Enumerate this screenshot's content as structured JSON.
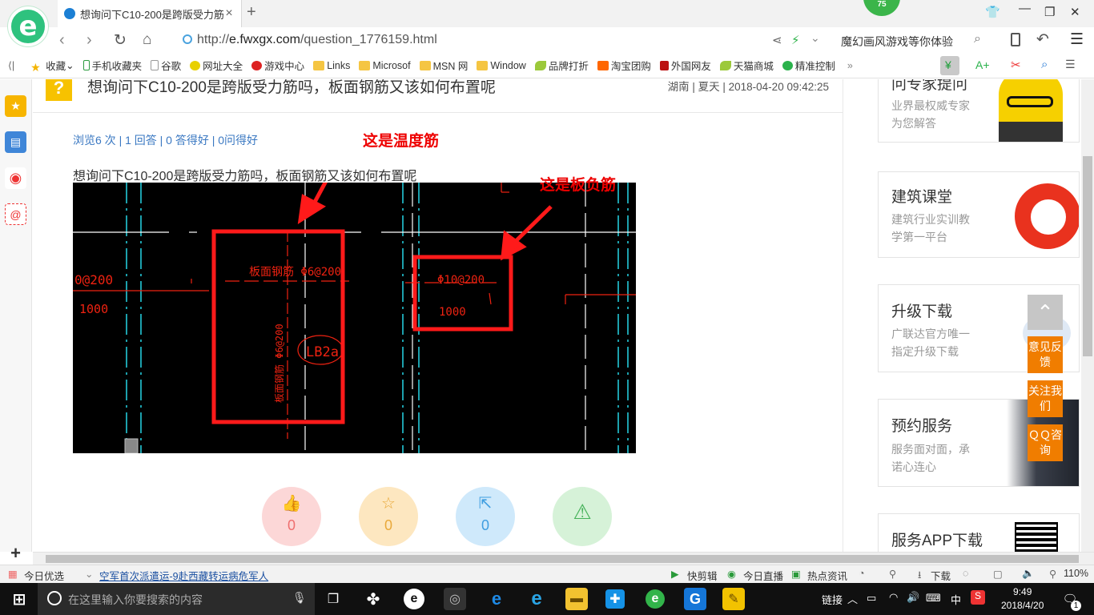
{
  "browser": {
    "tab_title": "想询问下C10-200是跨版受力筋吗",
    "tab_close": "×",
    "new_tab": "+",
    "badge_count": "75",
    "url_prefix": "http://",
    "url_domain": "e.fwxgx.com",
    "url_path": "/question_1776159.html",
    "search_text": "魔幻画风游戏等你体验"
  },
  "bookmarks": [
    {
      "label": "收藏",
      "icon": "star-icon"
    },
    {
      "label": "手机收藏夹",
      "icon": "phone-icon"
    },
    {
      "label": "谷歌",
      "icon": "page-icon"
    },
    {
      "label": "网址大全",
      "icon": "globe-icon"
    },
    {
      "label": "游戏中心",
      "icon": "game-icon"
    },
    {
      "label": "Links",
      "icon": "folder-icon"
    },
    {
      "label": "Microsof",
      "icon": "folder-icon"
    },
    {
      "label": "MSN 网",
      "icon": "folder-icon"
    },
    {
      "label": "Window",
      "icon": "folder-icon"
    },
    {
      "label": "品牌打折",
      "icon": "leaf-icon"
    },
    {
      "label": "淘宝团购",
      "icon": "taobao-icon"
    },
    {
      "label": "外国网友",
      "icon": "flag-icon"
    },
    {
      "label": "天猫商城",
      "icon": "leaf-icon"
    },
    {
      "label": "精准控制",
      "icon": "chat-icon"
    }
  ],
  "question": {
    "title": "想询问下C10-200是跨版受力筋吗，板面钢筋又该如何布置呢",
    "meta": "湖南 | 夏天 | 2018-04-20 09:42:25",
    "stats": "浏览6 次 | 1 回答 | 0 答得好 | 0问得好",
    "body": "想询问下C10-200是跨版受力筋吗，板面钢筋又该如何布置呢"
  },
  "drawing": {
    "annotation_temp": "这是温度筋",
    "annotation_neg": "这是板负筋",
    "label_left": "0@200",
    "label_left_len": "1000",
    "label_top": "板面钢筋 Φ6@200",
    "label_vertical": "板面钢筋 Φ6@200",
    "label_right": "Φ10@200",
    "label_right_len": "1000",
    "label_slab": "LB2a"
  },
  "actions": [
    {
      "icon": "thumbs-up-icon",
      "glyph": "👍",
      "count": "0",
      "bg": "#fcd7d7",
      "fg": "#ef6f6f"
    },
    {
      "icon": "star-icon",
      "glyph": "☆",
      "count": "0",
      "bg": "#fde7c0",
      "fg": "#e9a93a"
    },
    {
      "icon": "share-icon",
      "glyph": "⇱",
      "count": "0",
      "bg": "#cfe9fb",
      "fg": "#3f9ee0"
    },
    {
      "icon": "warning-icon",
      "glyph": "⚠",
      "count": "",
      "bg": "#d6f2d8",
      "fg": "#46b25a"
    }
  ],
  "right_cards": [
    {
      "title": "问专家提问",
      "sub1": "业界最权威专家",
      "sub2": "为您解答"
    },
    {
      "title": "建筑课堂",
      "sub1": "建筑行业实训教",
      "sub2": "学第一平台"
    },
    {
      "title": "升级下载",
      "sub1": "广联达官方唯一",
      "sub2": "指定升级下载"
    },
    {
      "title": "预约服务",
      "sub1": "服务面对面，承",
      "sub2": "诺心连心"
    },
    {
      "title": "服务APP下载",
      "sub1": "",
      "sub2": ""
    }
  ],
  "float_buttons": [
    "意见反馈",
    "关注我们",
    "ＱＱ咨询"
  ],
  "status_bar": {
    "today": "今日优选",
    "news": "空军首次派遣运-9赴西藏转运病危军人",
    "clip": "快剪辑",
    "live": "今日直播",
    "hot": "热点资讯",
    "download": "下载",
    "zoom": "110%"
  },
  "taskbar": {
    "search_placeholder": "在这里输入你要搜索的内容",
    "link": "链接",
    "ime": "中",
    "time": "9:49",
    "date": "2018/4/20",
    "notif": "1"
  }
}
